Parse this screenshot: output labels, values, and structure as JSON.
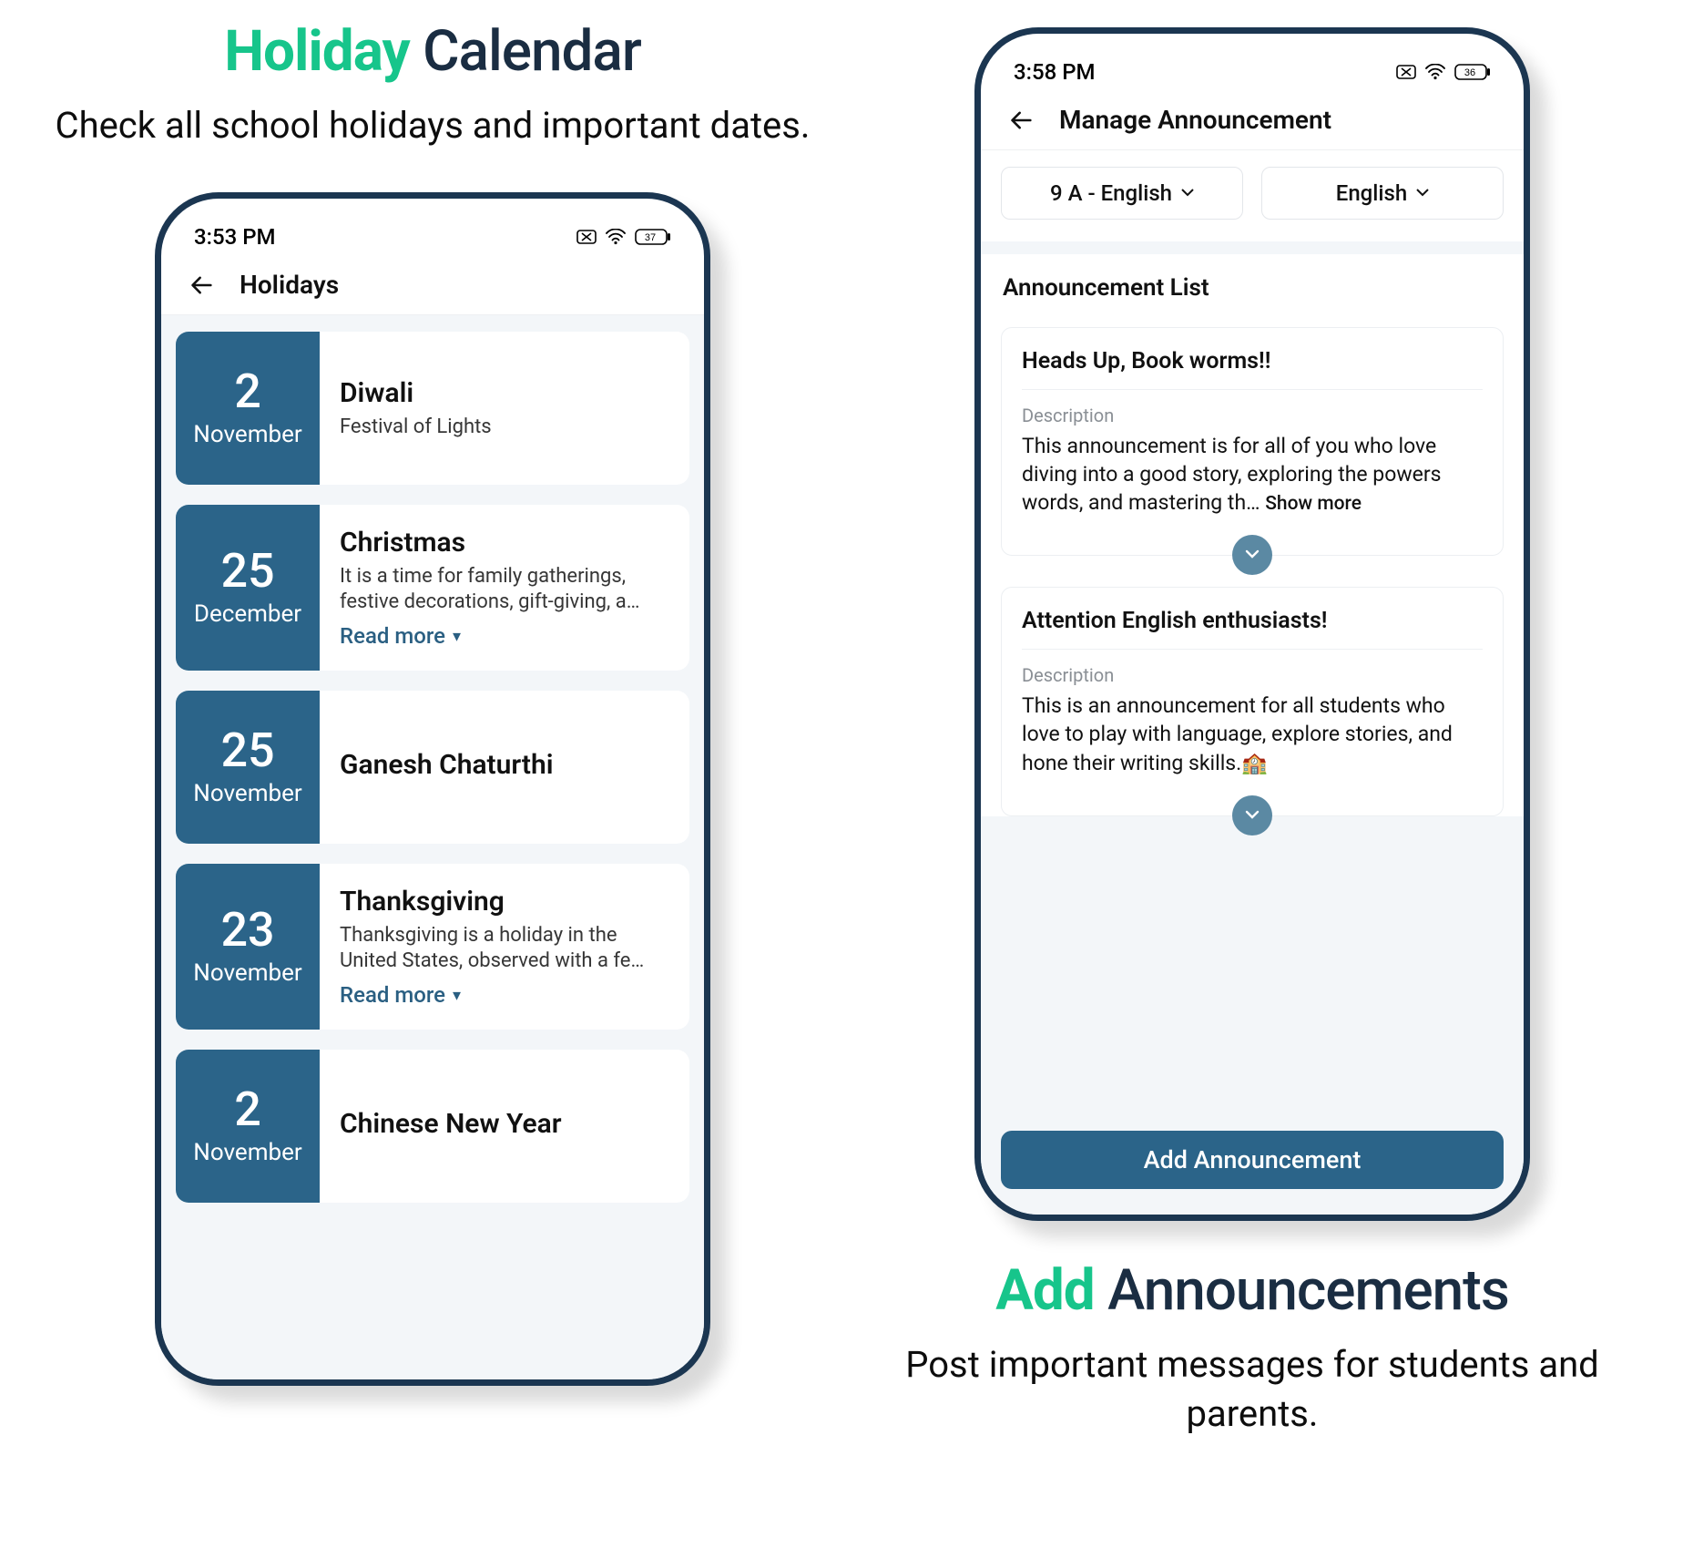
{
  "left": {
    "title_accent": "Holiday",
    "title_rest": " Calendar",
    "subtitle": "Check all school holidays and important dates.",
    "status_time": "3:53 PM",
    "battery": "37",
    "screen_title": "Holidays",
    "read_more_label": "Read more",
    "holidays": [
      {
        "day": "2",
        "month": "November",
        "title": "Diwali",
        "desc": "Festival of Lights",
        "readmore": false
      },
      {
        "day": "25",
        "month": "December",
        "title": "Christmas",
        "desc": "It is a time for family gatherings, festive decorations, gift-giving, a…",
        "readmore": true
      },
      {
        "day": "25",
        "month": "November",
        "title": "Ganesh Chaturthi",
        "desc": "",
        "readmore": false
      },
      {
        "day": "23",
        "month": "November",
        "title": "Thanksgiving",
        "desc": "Thanksgiving is a holiday in the United States, observed with a fe…",
        "readmore": true
      },
      {
        "day": "2",
        "month": "November",
        "title": "Chinese New Year",
        "desc": "",
        "readmore": false
      }
    ]
  },
  "right": {
    "title_accent": "Add",
    "title_rest": " Announcements",
    "subtitle": "Post important messages for students and parents.",
    "status_time": "3:58 PM",
    "battery": "36",
    "screen_title": "Manage Announcement",
    "filter_class": "9 A - English",
    "filter_lang": "English",
    "list_title": "Announcement List",
    "desc_label": "Description",
    "showmore_label": "Show more",
    "add_button": "Add Announcement",
    "announcements": [
      {
        "title": "Heads Up, Book worms!!",
        "desc": "This announcement is for all of you who love diving into a good story, exploring the powers words, and mastering th… ",
        "showmore": true
      },
      {
        "title": "Attention English enthusiasts!",
        "desc": "This is an announcement for all students who love to play with language, explore stories, and hone their writing skills.🏫",
        "showmore": false
      }
    ]
  },
  "colors": {
    "brand_dark_blue": "#2b6489",
    "accent_green": "#17c58b"
  }
}
